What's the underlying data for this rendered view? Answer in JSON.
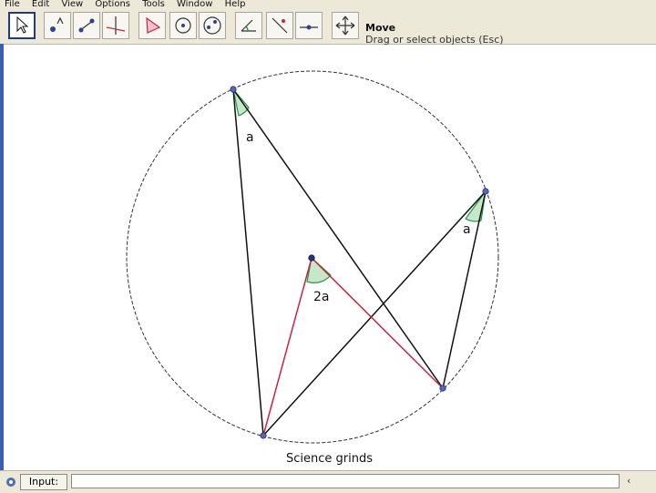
{
  "menu": [
    "File",
    "Edit",
    "View",
    "Options",
    "Tools",
    "Window",
    "Help"
  ],
  "toolbar": {
    "tools": [
      "move",
      "point",
      "line",
      "perpendicular",
      "polygon",
      "circle",
      "conic",
      "angle",
      "reflect",
      "text",
      "slider",
      "move-graphics"
    ],
    "active_tool": "move",
    "tool_name": "Move",
    "tool_help": "Drag or select objects (Esc)"
  },
  "colors": {
    "circle": "#333333",
    "black_line": "#111111",
    "red_line": "#cc2244",
    "angle": "#229944",
    "angle_fill": "#c8e6c8",
    "point": "#5566bb"
  },
  "labels": {
    "angle_a1": "a",
    "angle_a2": "a",
    "angle_2a": "2a"
  },
  "caption": "Science grinds",
  "input_bar": {
    "label": "Input:",
    "value": "",
    "cmd_arrow": "‹"
  }
}
